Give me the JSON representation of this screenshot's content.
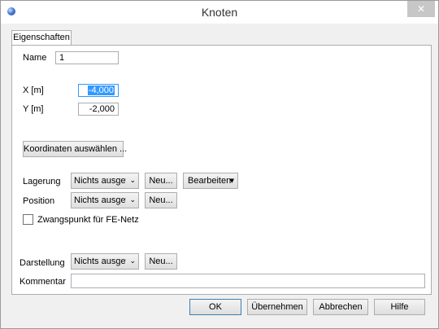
{
  "window": {
    "title": "Knoten",
    "close_glyph": "✕"
  },
  "tabs": [
    {
      "label": "Eigenschaften",
      "active": true
    }
  ],
  "form": {
    "name_label": "Name",
    "name_value": "1",
    "x_label": "X [m]",
    "x_value": "-4,000",
    "y_label": "Y [m]",
    "y_value": "-2,000",
    "coord_button": "Koordinaten auswählen ...",
    "lagerung_label": "Lagerung",
    "lagerung_value": "Nichts ausgewählt",
    "lagerung_new": "Neu...",
    "lagerung_edit": "Bearbeiten",
    "position_label": "Position",
    "position_value": "Nichts ausgewählt",
    "position_new": "Neu...",
    "zwang_label": "Zwangspunkt für FE-Netz",
    "zwang_checked": false,
    "darstellung_label": "Darstellung",
    "darstellung_value": "Nichts ausgewählt",
    "darstellung_new": "Neu...",
    "kommentar_label": "Kommentar",
    "kommentar_value": ""
  },
  "footer": {
    "ok": "OK",
    "apply": "Übernehmen",
    "cancel": "Abbrechen",
    "help": "Hilfe"
  },
  "icons": {
    "app": "app-globe-icon",
    "dropdown": "chevron-down-icon",
    "split": "caret-down-icon"
  },
  "colors": {
    "selection": "#3399ff",
    "focus_border": "#3399ff",
    "default_button_border": "#3c7fb1"
  }
}
